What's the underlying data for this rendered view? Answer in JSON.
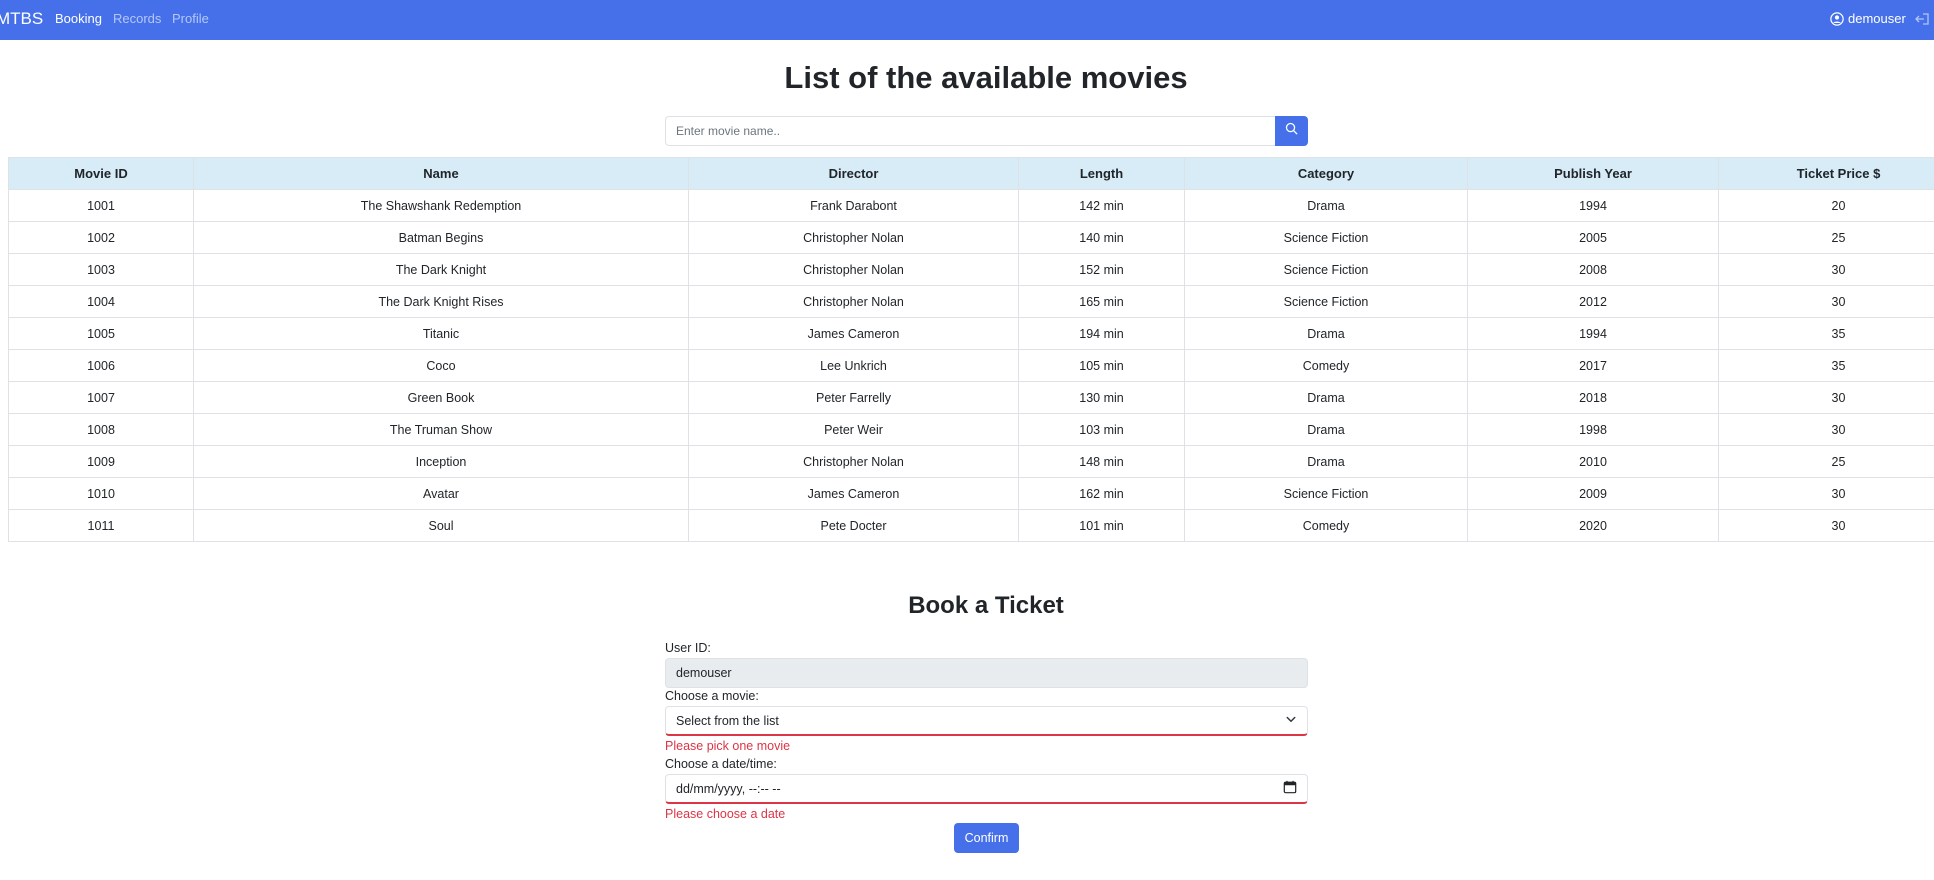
{
  "navbar": {
    "brand": "MTBS",
    "links": [
      "Booking",
      "Records",
      "Profile"
    ],
    "username": "demouser",
    "colors": {
      "background": "#4570ea"
    }
  },
  "movies_section": {
    "title": "List of the available movies",
    "search": {
      "placeholder": "Enter movie name.."
    },
    "table": {
      "columns": [
        "Movie ID",
        "Name",
        "Director",
        "Length",
        "Category",
        "Publish Year",
        "Ticket Price $"
      ],
      "rows": [
        [
          "1001",
          "The Shawshank Redemption",
          "Frank Darabont",
          "142 min",
          "Drama",
          "1994",
          "20"
        ],
        [
          "1002",
          "Batman Begins",
          "Christopher Nolan",
          "140 min",
          "Science Fiction",
          "2005",
          "25"
        ],
        [
          "1003",
          "The Dark Knight",
          "Christopher Nolan",
          "152 min",
          "Science Fiction",
          "2008",
          "30"
        ],
        [
          "1004",
          "The Dark Knight Rises",
          "Christopher Nolan",
          "165 min",
          "Science Fiction",
          "2012",
          "30"
        ],
        [
          "1005",
          "Titanic",
          "James Cameron",
          "194 min",
          "Drama",
          "1994",
          "35"
        ],
        [
          "1006",
          "Coco",
          "Lee Unkrich",
          "105 min",
          "Comedy",
          "2017",
          "35"
        ],
        [
          "1007",
          "Green Book",
          "Peter Farrelly",
          "130 min",
          "Drama",
          "2018",
          "30"
        ],
        [
          "1008",
          "The Truman Show",
          "Peter Weir",
          "103 min",
          "Drama",
          "1998",
          "30"
        ],
        [
          "1009",
          "Inception",
          "Christopher Nolan",
          "148 min",
          "Drama",
          "2010",
          "25"
        ],
        [
          "1010",
          "Avatar",
          "James Cameron",
          "162 min",
          "Science Fiction",
          "2009",
          "30"
        ],
        [
          "1011",
          "Soul",
          "Pete Docter",
          "101 min",
          "Comedy",
          "2020",
          "30"
        ]
      ],
      "header_color": "#d8ecf8"
    }
  },
  "booking": {
    "title": "Book a Ticket",
    "user_id_label": "User ID:",
    "user_id_value": "demouser",
    "movie_label": "Choose a movie:",
    "movie_select_value": "Select from the list",
    "movie_error": "Please pick one movie",
    "date_label": "Choose a date/time:",
    "date_value": "dd/mm/yyyy, --:-- --",
    "date_error": "Please choose a date",
    "confirm_label": "Confirm",
    "colors": {
      "error": "#dc3545",
      "primary": "#4570ea"
    }
  },
  "icons": [
    "user-circle-icon",
    "logout-icon",
    "search-icon",
    "chevron-down-icon",
    "calendar-icon"
  ]
}
